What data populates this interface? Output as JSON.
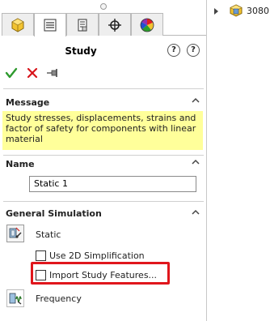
{
  "panel": {
    "tabs": [
      {
        "name": "feature-manager-tab",
        "icon": "part-icon"
      },
      {
        "name": "property-manager-tab",
        "icon": "property-list-icon"
      },
      {
        "name": "configuration-manager-tab",
        "icon": "configuration-icon"
      },
      {
        "name": "dimxpert-tab",
        "icon": "crosshair-icon"
      },
      {
        "name": "display-manager-tab",
        "icon": "color-wheel-icon"
      }
    ],
    "title": "Study",
    "help_icons": [
      "?",
      "?"
    ],
    "actions": {
      "ok": "✓",
      "cancel": "✕",
      "pin": "pin-icon"
    },
    "message": {
      "header": "Message",
      "text": "Study stresses, displacements, strains and factor of safety  for components with linear material"
    },
    "name_section": {
      "header": "Name",
      "value": "Static 1"
    },
    "general_simulation": {
      "header": "General Simulation",
      "static_label": "Static",
      "use_2d_label": "Use 2D Simplification",
      "import_features_label": "Import Study Features...",
      "frequency_label": "Frequency"
    }
  },
  "tree": {
    "item_label": "3080 -"
  },
  "colors": {
    "message_bg": "#ffff9a",
    "highlight": "#e0161c",
    "ok_green": "#2e9a2e",
    "cancel_red": "#d8141b"
  }
}
